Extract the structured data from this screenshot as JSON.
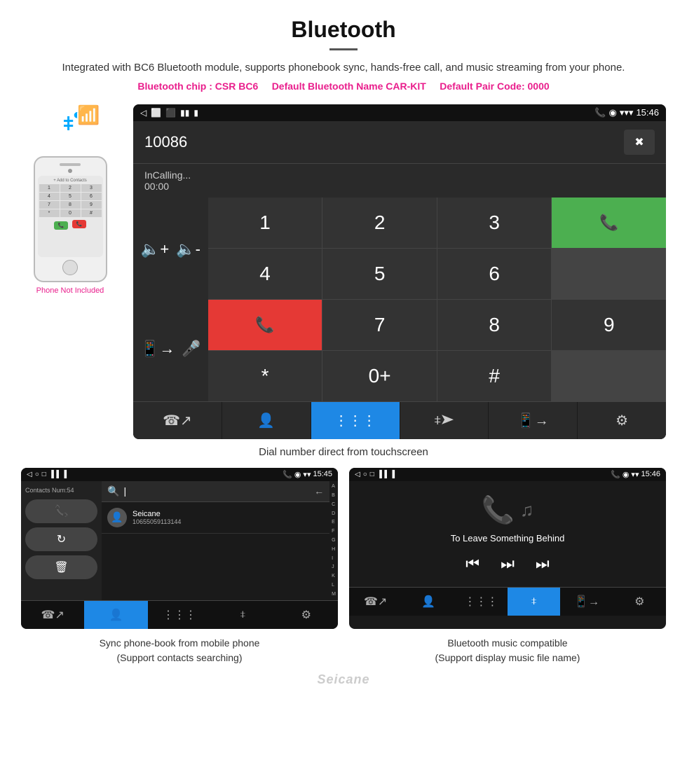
{
  "page": {
    "title": "Bluetooth",
    "subtitle": "Integrated with BC6 Bluetooth module, supports phonebook sync, hands-free call, and music streaming from your phone.",
    "specs": {
      "chip": "Bluetooth chip : CSR BC6",
      "name": "Default Bluetooth Name CAR-KIT",
      "code": "Default Pair Code: 0000"
    }
  },
  "phone_mock": {
    "label": "Phone Not Included",
    "screen_label": "+ Add to Contacts"
  },
  "dial_screen": {
    "status_bar": {
      "left_icons": [
        "◁",
        "⬜",
        "⬛"
      ],
      "right_icons": "📞 ◉ ▾ 15:46"
    },
    "number": "10086",
    "calling_status": "InCalling...",
    "timer": "00:00",
    "keys": [
      "1",
      "2",
      "3",
      "*",
      "4",
      "5",
      "6",
      "0+",
      "7",
      "8",
      "9",
      "#"
    ],
    "bottom_bar": [
      "📞↗",
      "👤",
      "⬛⬛⬛",
      "✱)",
      "⬛→",
      "⚙"
    ]
  },
  "caption_main": "Dial number direct from touchscreen",
  "contacts_screen": {
    "status_bar": {
      "time": "15:45"
    },
    "contacts_num": "Contacts Num:54",
    "search_placeholder": "Search",
    "contact": {
      "name": "Seicane",
      "phone": "10655059113144"
    },
    "alpha": [
      "A",
      "B",
      "C",
      "D",
      "E",
      "F",
      "G",
      "H",
      "I",
      "J",
      "K",
      "L",
      "M"
    ]
  },
  "music_screen": {
    "status_bar": {
      "time": "15:46"
    },
    "song_title": "To Leave Something Behind",
    "controls": [
      "⏮",
      "⏭",
      "⏭"
    ]
  },
  "bottom_captions": {
    "left": "Sync phone-book from mobile phone\n(Support contacts searching)",
    "right": "Bluetooth music compatible\n(Support display music file name)"
  },
  "watermark": "Seicane"
}
